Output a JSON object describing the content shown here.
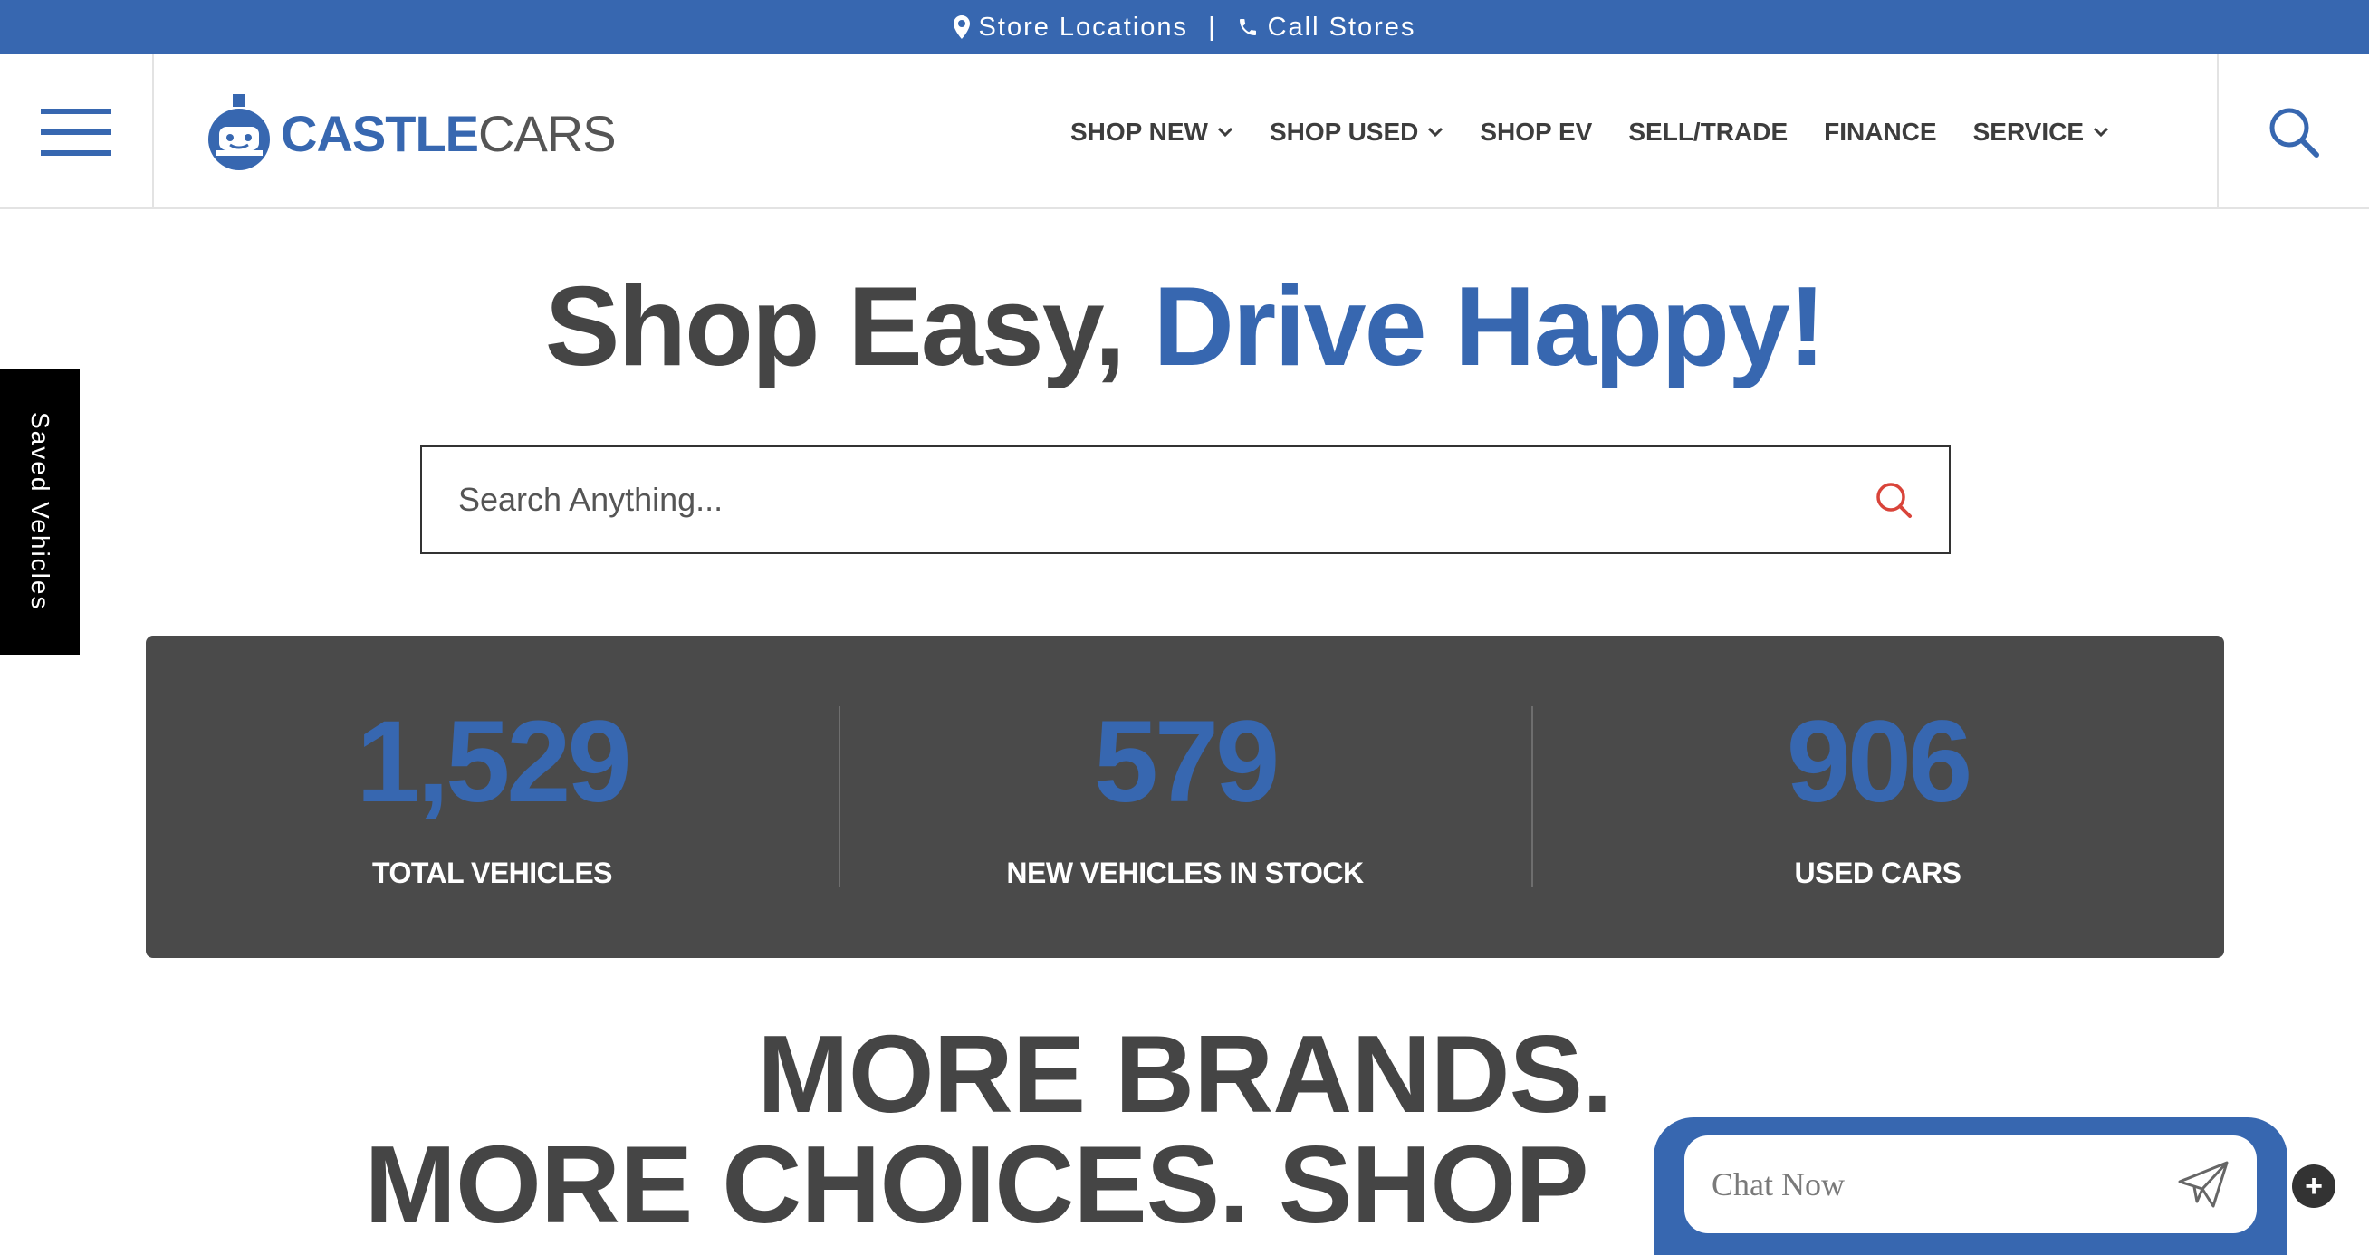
{
  "topbar": {
    "store_locations": "Store Locations",
    "separator": "|",
    "call_stores": "Call Stores"
  },
  "header": {
    "logo_castle": "CASTLE",
    "logo_cars": "CARS",
    "nav": [
      {
        "label": "SHOP NEW",
        "dropdown": true
      },
      {
        "label": "SHOP USED",
        "dropdown": true
      },
      {
        "label": "SHOP EV",
        "dropdown": false
      },
      {
        "label": "SELL/TRADE",
        "dropdown": false
      },
      {
        "label": "FINANCE",
        "dropdown": false
      },
      {
        "label": "SERVICE",
        "dropdown": true
      }
    ]
  },
  "saved_tab": "Saved Vehicles",
  "hero": {
    "title_dark": "Shop Easy, ",
    "title_blue": "Drive Happy!",
    "search_placeholder": "Search Anything..."
  },
  "stats": [
    {
      "value": "1,529",
      "label": "TOTAL VEHICLES"
    },
    {
      "value": "579",
      "label": "NEW VEHICLES IN STOCK"
    },
    {
      "value": "906",
      "label": "USED CARS"
    }
  ],
  "brands": {
    "line1": "MORE BRANDS.",
    "line2": "MORE CHOICES. SHOP"
  },
  "chat": {
    "placeholder": "Chat Now",
    "plus": "+"
  },
  "colors": {
    "brand_blue": "#3767b0",
    "dark_panel": "#4a4a4a",
    "search_icon_red": "#d9443a"
  }
}
